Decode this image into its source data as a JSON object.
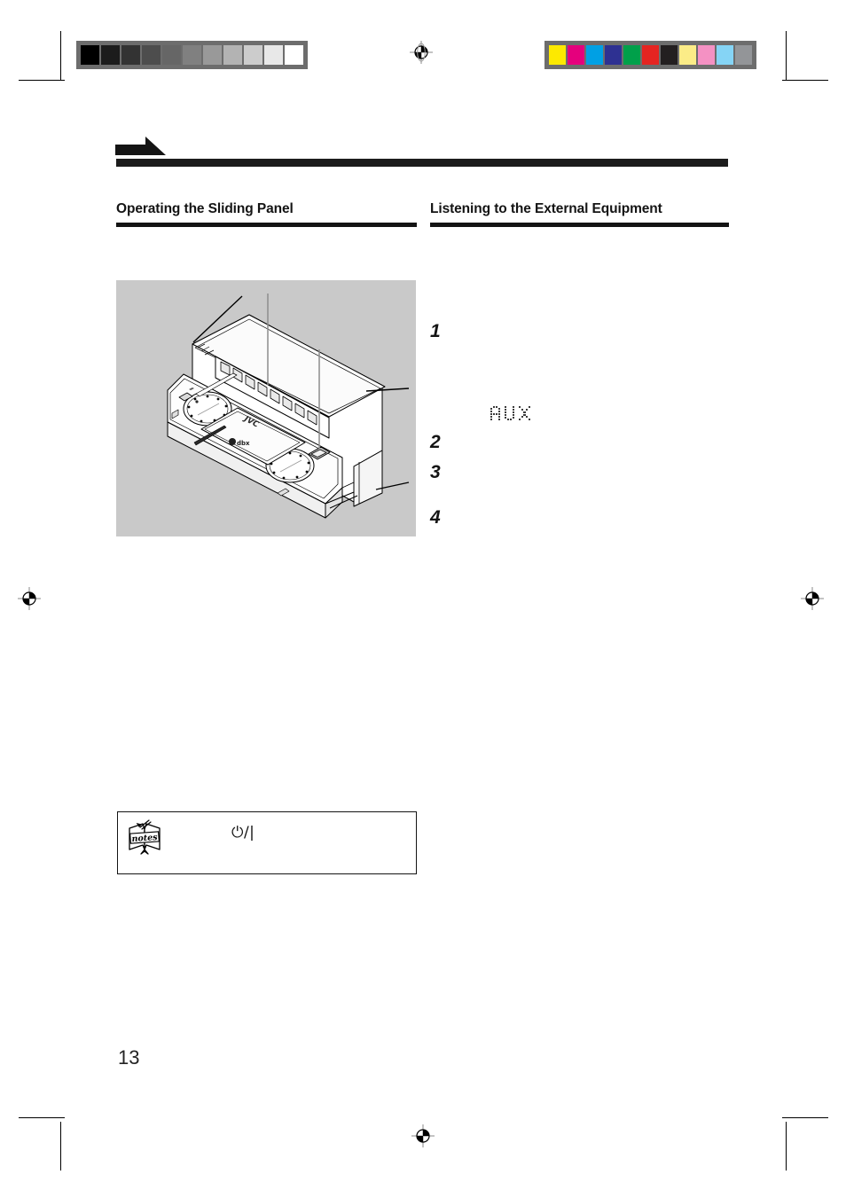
{
  "document": {
    "page_number": "13",
    "arrow_marker": "right-arrow-flag"
  },
  "calibration": {
    "grayscale_label": "grayscale-calibration-bar",
    "grayscale_swatches": [
      "#000000",
      "#1c1c1c",
      "#333333",
      "#4d4d4d",
      "#666666",
      "#808080",
      "#999999",
      "#b3b3b3",
      "#cccccc",
      "#e8e8e8",
      "#ffffff"
    ],
    "color_label": "color-calibration-bar",
    "color_swatches": [
      "#fde900",
      "#e5007d",
      "#00a0e4",
      "#2e3192",
      "#00a04a",
      "#e52421",
      "#231f20",
      "#fbec87",
      "#f491c3",
      "#85d4f5",
      "#939598"
    ]
  },
  "sections": {
    "left": {
      "heading": "Operating the Sliding Panel"
    },
    "right": {
      "heading": "Listening to the External Equipment",
      "steps": [
        {
          "number": "1",
          "body": ""
        },
        {
          "number": "2",
          "body": ""
        },
        {
          "number": "3",
          "body": ""
        },
        {
          "number": "4",
          "body": ""
        }
      ],
      "display_readout": "AUX"
    }
  },
  "illustration": {
    "name": "sliding-panel-audio-system-diagram",
    "brand_mark": "JVC",
    "callout_count": 3
  },
  "notes": {
    "icon_label": "notes",
    "power_symbol": "⏻/|",
    "body": ""
  }
}
